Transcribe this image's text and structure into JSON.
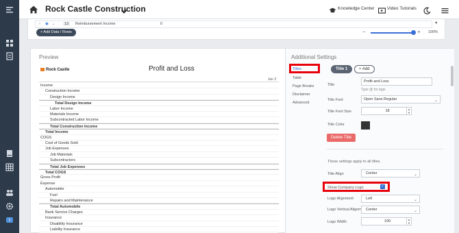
{
  "app": {
    "company_name": "Rock Castle Construction",
    "knowledge_center": "Knowledge Center",
    "video_tutorials": "Video Tutorials"
  },
  "strip": {
    "row_num": "13",
    "row_label": "Reimbursement Income",
    "row_value": "0",
    "add_button": "+ Add Data / Rows",
    "zoom_value": "100%",
    "zoom_level": 1.0
  },
  "preview": {
    "heading": "Preview",
    "logo_text": "Rock Castle",
    "report_title": "Profit and Loss",
    "column_header": "Jun 2",
    "rows": [
      {
        "label": "Income",
        "indent": 0,
        "bold": false
      },
      {
        "label": "Construction Income",
        "indent": 1,
        "bold": false
      },
      {
        "label": "Design Income",
        "indent": 2,
        "bold": false
      },
      {
        "label": "Total Design Income",
        "indent": 3,
        "bold": true
      },
      {
        "label": "Labor Income",
        "indent": 2,
        "bold": false
      },
      {
        "label": "Materials Income",
        "indent": 2,
        "bold": false
      },
      {
        "label": "Subcontracted Labor Income",
        "indent": 2,
        "bold": false
      },
      {
        "label": "Total Construction Income",
        "indent": 2,
        "bold": true
      },
      {
        "label": "Total Income",
        "indent": 1,
        "bold": true
      },
      {
        "label": "COGS",
        "indent": 0,
        "bold": false
      },
      {
        "label": "Cost of Goods Sold",
        "indent": 1,
        "bold": false
      },
      {
        "label": "Job Expenses",
        "indent": 1,
        "bold": false
      },
      {
        "label": "Job Materials",
        "indent": 2,
        "bold": false
      },
      {
        "label": "Subcontractors",
        "indent": 2,
        "bold": false
      },
      {
        "label": "Total Job Expenses",
        "indent": 2,
        "bold": true
      },
      {
        "label": "Total COGS",
        "indent": 1,
        "bold": true
      },
      {
        "label": "Gross Profit",
        "indent": 0,
        "bold": false
      },
      {
        "label": "Expense",
        "indent": 0,
        "bold": false
      },
      {
        "label": "Automobile",
        "indent": 1,
        "bold": false
      },
      {
        "label": "Fuel",
        "indent": 2,
        "bold": false
      },
      {
        "label": "Repairs and Maintenance",
        "indent": 2,
        "bold": false
      },
      {
        "label": "Total Automobile",
        "indent": 2,
        "bold": true
      },
      {
        "label": "Bank Service Charges",
        "indent": 1,
        "bold": false
      },
      {
        "label": "Insurance",
        "indent": 1,
        "bold": false
      },
      {
        "label": "Disability Insurance",
        "indent": 2,
        "bold": false
      },
      {
        "label": "Liability Insurance",
        "indent": 2,
        "bold": false
      },
      {
        "label": "Work Comp",
        "indent": 2,
        "bold": false
      }
    ]
  },
  "settings": {
    "heading": "Additional Settings",
    "nav": [
      "Titles",
      "Table",
      "Page Breaks",
      "Disclaimer",
      "Advanced"
    ],
    "tab_active": "Title 1",
    "tab_add": "+ Add",
    "title_label": "Title",
    "title_value": "Profit and Loss",
    "title_hint": "Type @ for tags",
    "font_label": "Title Font",
    "font_value": "Open Sans Regular",
    "size_label": "Title Font Size",
    "size_value": "18",
    "color_label": "Title Color",
    "title_color": "#333333",
    "delete_button": "Delete Title",
    "note": "These settings apply to all titles.",
    "align_label": "Title Align",
    "align_value": "Center",
    "show_logo_label": "Show Company Logo",
    "show_logo_checked": true,
    "logo_align_label": "Logo Alignment",
    "logo_align_value": "Left",
    "logo_valign_label": "Logo Vertical Alignment",
    "logo_valign_value": "Center",
    "logo_width_label": "Logo Width",
    "logo_width_value": "100"
  },
  "colors": {
    "highlight": "#e8000b",
    "accent": "#2f6fd6",
    "rail": "#2d3a4a",
    "delete": "#ea6a6a"
  }
}
